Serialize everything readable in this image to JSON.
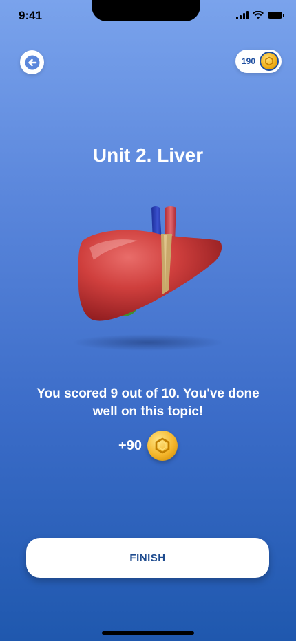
{
  "status_bar": {
    "time": "9:41",
    "icons": [
      "cellular-signal-icon",
      "wifi-icon",
      "battery-icon"
    ]
  },
  "header": {
    "back_icon": "arrow-left-icon",
    "coin_balance": "190",
    "coin_icon": "coin-icon"
  },
  "main": {
    "title": "Unit 2. Liver",
    "illustration": "liver-illustration",
    "result_text": "You scored 9 out of 10. You've done well on this topic!",
    "reward_amount": "+90",
    "reward_icon": "coin-icon"
  },
  "actions": {
    "finish_label": "FINISH"
  },
  "colors": {
    "background_top": "#7aa3ec",
    "background_bottom": "#1f58ae",
    "accent": "#1f4fa0",
    "coin": "#f4b52a",
    "button_text": "#1f4c8f"
  }
}
